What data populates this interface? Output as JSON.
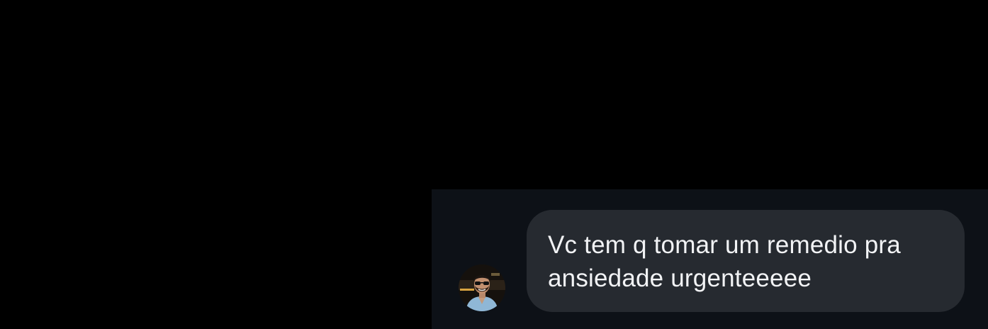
{
  "conversation": {
    "messages": [
      {
        "sender_avatar": "profile-photo",
        "text": "Vc tem q tomar um remedio pra ansiedade urgenteeeee"
      }
    ]
  },
  "colors": {
    "screen_background": "#000000",
    "chat_background": "#0d1117",
    "bubble_background": "#262a30",
    "text": "#f2f3f5"
  }
}
